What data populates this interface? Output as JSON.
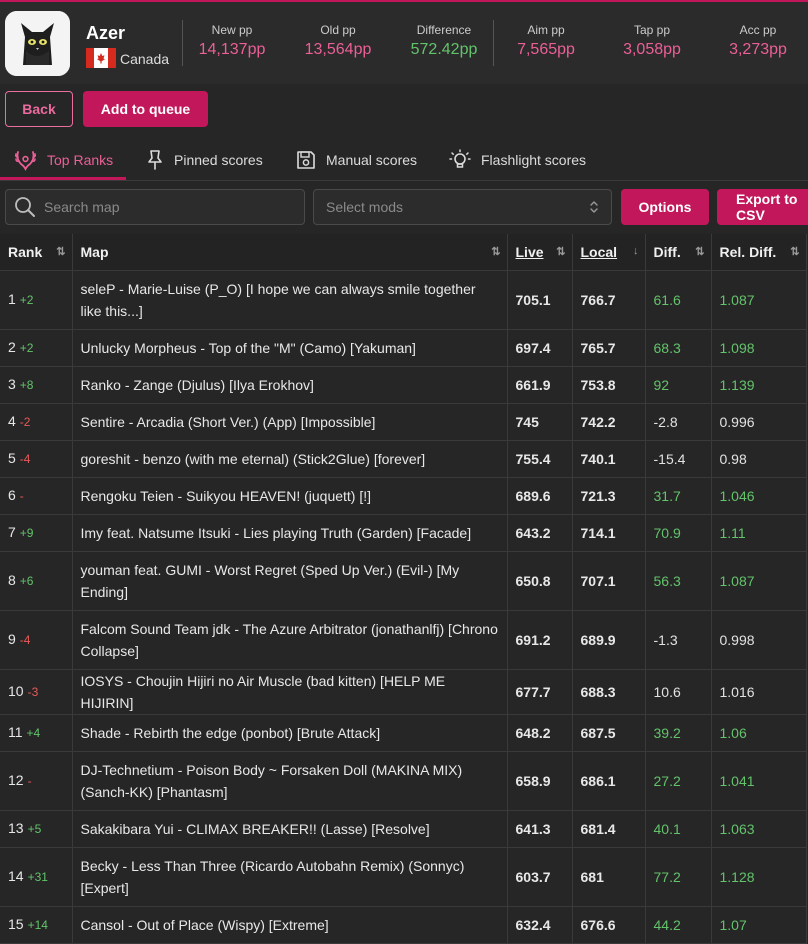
{
  "profile": {
    "username": "Azer",
    "country": "Canada"
  },
  "stats": [
    {
      "label": "New pp",
      "value": "14,137pp",
      "color": "pink"
    },
    {
      "label": "Old pp",
      "value": "13,564pp",
      "color": "pink"
    },
    {
      "label": "Difference",
      "value": "572.42pp",
      "color": "green"
    },
    {
      "label": "Aim pp",
      "value": "7,565pp",
      "color": "pink"
    },
    {
      "label": "Tap pp",
      "value": "3,058pp",
      "color": "pink"
    },
    {
      "label": "Acc pp",
      "value": "3,273pp",
      "color": "pink"
    }
  ],
  "buttons": {
    "back": "Back",
    "queue": "Add to queue",
    "options": "Options",
    "export": "Export to CSV"
  },
  "tabs": [
    {
      "label": "Top Ranks",
      "icon": "laurel-icon",
      "active": true
    },
    {
      "label": "Pinned scores",
      "icon": "pin-icon",
      "active": false
    },
    {
      "label": "Manual scores",
      "icon": "save-icon",
      "active": false
    },
    {
      "label": "Flashlight scores",
      "icon": "lightbulb-icon",
      "active": false
    }
  ],
  "controls": {
    "search_placeholder": "Search map",
    "mods_placeholder": "Select mods"
  },
  "table": {
    "headers": [
      "Rank",
      "Map",
      "Live",
      "Local",
      "Diff.",
      "Rel. Diff."
    ],
    "rows": [
      {
        "rank": "1",
        "change": "+2",
        "map": "seleP - Marie-Luise (P_O) [I hope we can always smile together like this...]",
        "live": "705.1",
        "local": "766.7",
        "diff": "61.6",
        "rel": "1.087"
      },
      {
        "rank": "2",
        "change": "+2",
        "map": "Unlucky Morpheus - Top of the \"M\" (Camo) [Yakuman]",
        "live": "697.4",
        "local": "765.7",
        "diff": "68.3",
        "rel": "1.098"
      },
      {
        "rank": "3",
        "change": "+8",
        "map": "Ranko - Zange (Djulus) [Ilya Erokhov]",
        "live": "661.9",
        "local": "753.8",
        "diff": "92",
        "rel": "1.139"
      },
      {
        "rank": "4",
        "change": "-2",
        "map": "Sentire - Arcadia (Short Ver.) (App) [Impossible]",
        "live": "745",
        "local": "742.2",
        "diff": "-2.8",
        "rel": "0.996"
      },
      {
        "rank": "5",
        "change": "-4",
        "map": "goreshit - benzo (with me eternal) (Stick2Glue) [forever]",
        "live": "755.4",
        "local": "740.1",
        "diff": "-15.4",
        "rel": "0.98"
      },
      {
        "rank": "6",
        "change": "-",
        "map": "Rengoku Teien - Suikyou HEAVEN! (juquett) [!]",
        "live": "689.6",
        "local": "721.3",
        "diff": "31.7",
        "rel": "1.046"
      },
      {
        "rank": "7",
        "change": "+9",
        "map": "Imy feat. Natsume Itsuki - Lies playing Truth (Garden) [Facade]",
        "live": "643.2",
        "local": "714.1",
        "diff": "70.9",
        "rel": "1.11"
      },
      {
        "rank": "8",
        "change": "+6",
        "map": "youman feat. GUMI - Worst Regret (Sped Up Ver.) (Evil-) [My Ending]",
        "live": "650.8",
        "local": "707.1",
        "diff": "56.3",
        "rel": "1.087"
      },
      {
        "rank": "9",
        "change": "-4",
        "map": "Falcom Sound Team jdk - The Azure Arbitrator (jonathanlfj) [Chrono Collapse]",
        "live": "691.2",
        "local": "689.9",
        "diff": "-1.3",
        "rel": "0.998"
      },
      {
        "rank": "10",
        "change": "-3",
        "map": "IOSYS - Choujin Hijiri no Air Muscle (bad kitten) [HELP ME HIJIRIN]",
        "live": "677.7",
        "local": "688.3",
        "diff": "10.6",
        "rel": "1.016"
      },
      {
        "rank": "11",
        "change": "+4",
        "map": "Shade - Rebirth the edge (ponbot) [Brute Attack]",
        "live": "648.2",
        "local": "687.5",
        "diff": "39.2",
        "rel": "1.06"
      },
      {
        "rank": "12",
        "change": "-",
        "map": "DJ-Technetium - Poison Body ~ Forsaken Doll (MAKINA MIX) (Sanch-KK) [Phantasm]",
        "live": "658.9",
        "local": "686.1",
        "diff": "27.2",
        "rel": "1.041"
      },
      {
        "rank": "13",
        "change": "+5",
        "map": "Sakakibara Yui - CLIMAX BREAKER!! (Lasse) [Resolve]",
        "live": "641.3",
        "local": "681.4",
        "diff": "40.1",
        "rel": "1.063"
      },
      {
        "rank": "14",
        "change": "+31",
        "map": "Becky - Less Than Three (Ricardo Autobahn Remix) (Sonnyc) [Expert]",
        "live": "603.7",
        "local": "681",
        "diff": "77.2",
        "rel": "1.128"
      },
      {
        "rank": "15",
        "change": "+14",
        "map": "Cansol - Out of Place (Wispy) [Extreme]",
        "live": "632.4",
        "local": "676.6",
        "diff": "44.2",
        "rel": "1.07"
      }
    ]
  },
  "colors": {
    "accent": "#c2185b",
    "pink_text": "#ec5f97",
    "green": "#63c36b",
    "red": "#e85a5a",
    "background": "#262626"
  }
}
